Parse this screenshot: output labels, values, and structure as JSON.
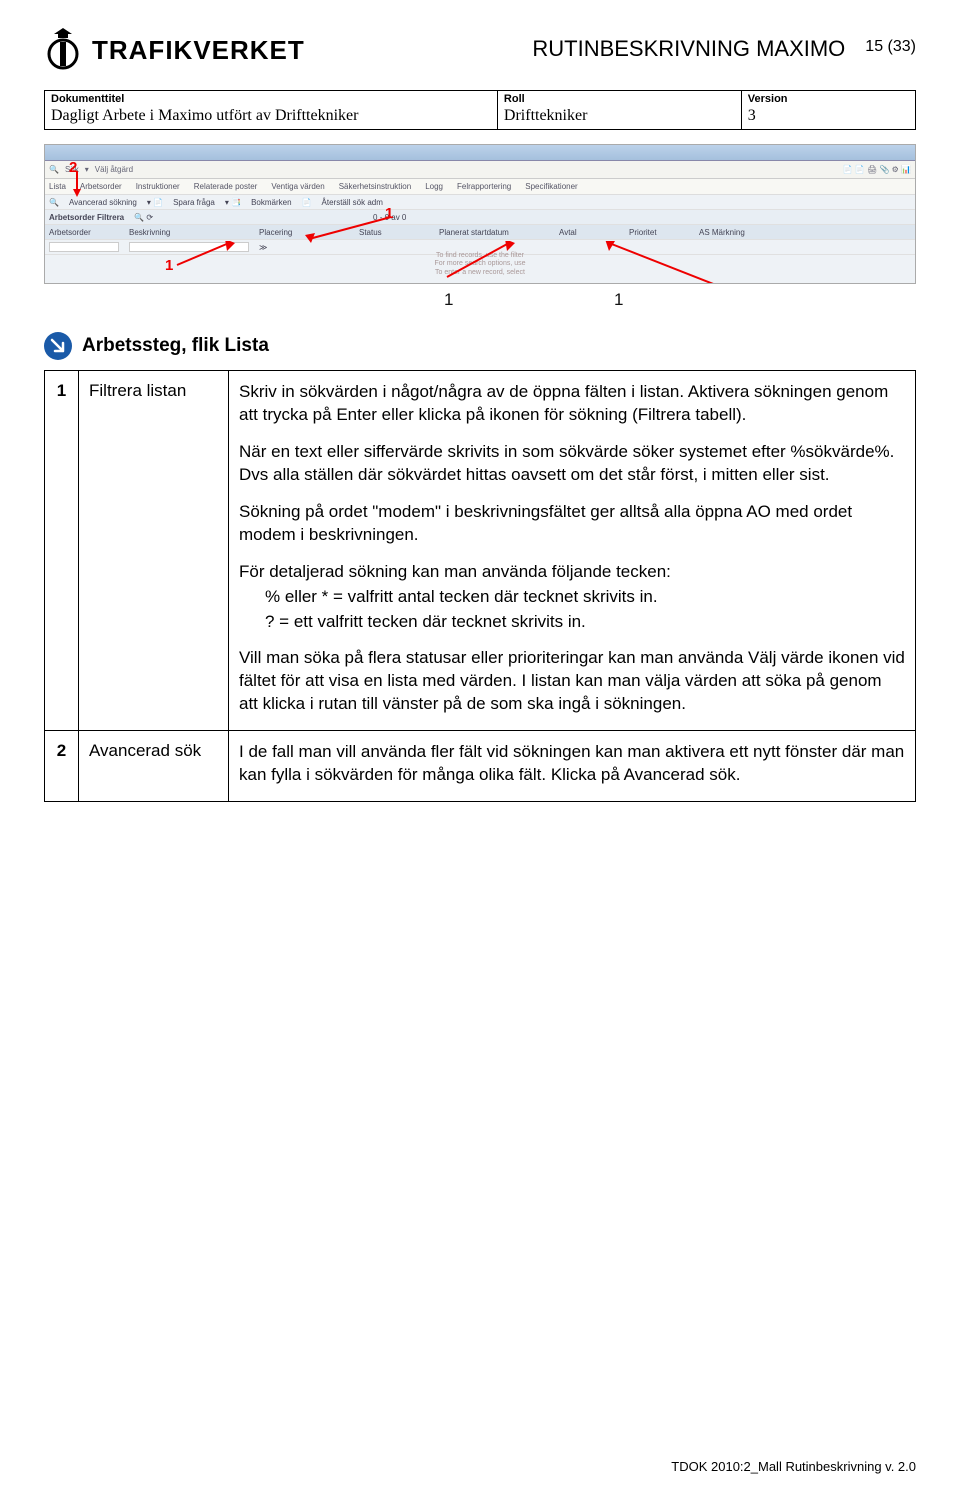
{
  "header": {
    "logo_text": "TRAFIKVERKET",
    "doc_title": "RUTINBESKRIVNING MAXIMO",
    "page_indicator": "15 (33)"
  },
  "meta": {
    "col1_head": "Dokumenttitel",
    "col1_val": "Dagligt Arbete i Maximo utfört av Drifttekniker",
    "col2_head": "Roll",
    "col2_val": "Drifttekniker",
    "col3_head": "Version",
    "col3_val": "3"
  },
  "screenshot": {
    "callout_2": "2",
    "callout_1a": "1",
    "callout_1b": "1",
    "callout_1c": "1",
    "callout_1d": "1",
    "toolbar": [
      "Sök",
      "Välj åtgärd"
    ],
    "tabs": [
      "Lista",
      "Arbetsorder",
      "Instruktioner",
      "Relaterade poster",
      "Ventiga värden",
      "Säkerhetsinstruktion",
      "Logg",
      "Felrapportering",
      "Specifikationer"
    ],
    "subbar": [
      "Avancerad sökning",
      "Spara fråga",
      "Bokmärken",
      "Återställ sök adm"
    ],
    "filter_label": "Arbetsorder   Filtrera",
    "count_label": "0 - 0 av 0",
    "cols": [
      "Arbetsorder",
      "Beskrivning",
      "Placering",
      "Status",
      "Planerat startdatum",
      "Avtal",
      "Prioritet",
      "AS Märkning"
    ],
    "hint": "To find records, use the filter\nFor more search options, use\nTo enter a new record, select"
  },
  "section": {
    "title": "Arbetssteg, flik Lista"
  },
  "rows": [
    {
      "num": "1",
      "label": "Filtrera listan",
      "paras": [
        "Skriv in sökvärden i något/några av de öppna fälten i listan. Aktivera sökningen genom att trycka på Enter eller klicka på ikonen för sökning (Filtrera tabell).",
        "När en text eller siffervärde skrivits in som sökvärde söker systemet efter %sökvärde%. Dvs alla ställen där sökvärdet hittas oavsett om det står först, i mitten eller sist.",
        "Sökning på ordet \"modem\" i beskrivningsfältet ger alltså alla öppna AO med ordet modem i beskrivningen.",
        "För detaljerad sökning kan man använda följande tecken:",
        "% eller *  = valfritt antal tecken där tecknet skrivits in.",
        "?             = ett valfritt tecken där tecknet skrivits in.",
        "Vill man söka på flera statusar eller prioriteringar kan man använda Välj värde ikonen vid fältet för att visa en lista med värden. I listan kan man välja värden att söka på genom att klicka i rutan till vänster på de som ska ingå i sökningen."
      ]
    },
    {
      "num": "2",
      "label": "Avancerad sök",
      "paras": [
        "I de fall man vill använda fler fält vid sökningen kan man aktivera ett nytt fönster där man kan fylla i sökvärden för många olika fält. Klicka på Avancerad sök."
      ]
    }
  ],
  "footer": "TDOK 2010:2_Mall Rutinbeskrivning v. 2.0"
}
